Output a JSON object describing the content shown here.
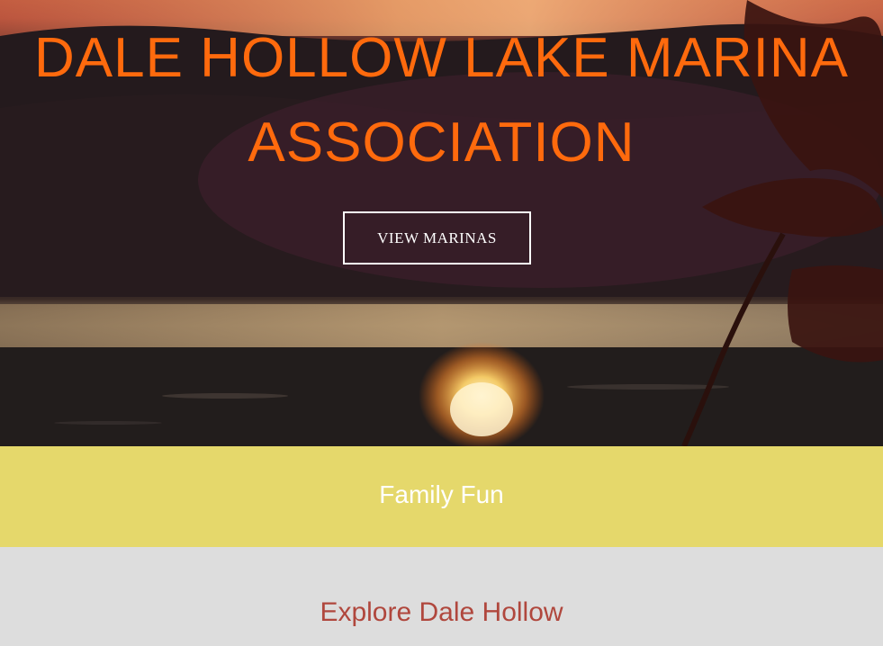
{
  "hero": {
    "title_line1": "DALE HOLLOW LAKE MARINA",
    "title_line2": "ASSOCIATION",
    "button_label": "VIEW MARINAS",
    "title_color": "#ff6a0d",
    "background_description_icon": "sunset-lake-photo"
  },
  "band": {
    "text": "Family Fun",
    "color": "#e5d86b"
  },
  "explore": {
    "title": "Explore Dale Hollow",
    "title_color": "#b0473d"
  }
}
